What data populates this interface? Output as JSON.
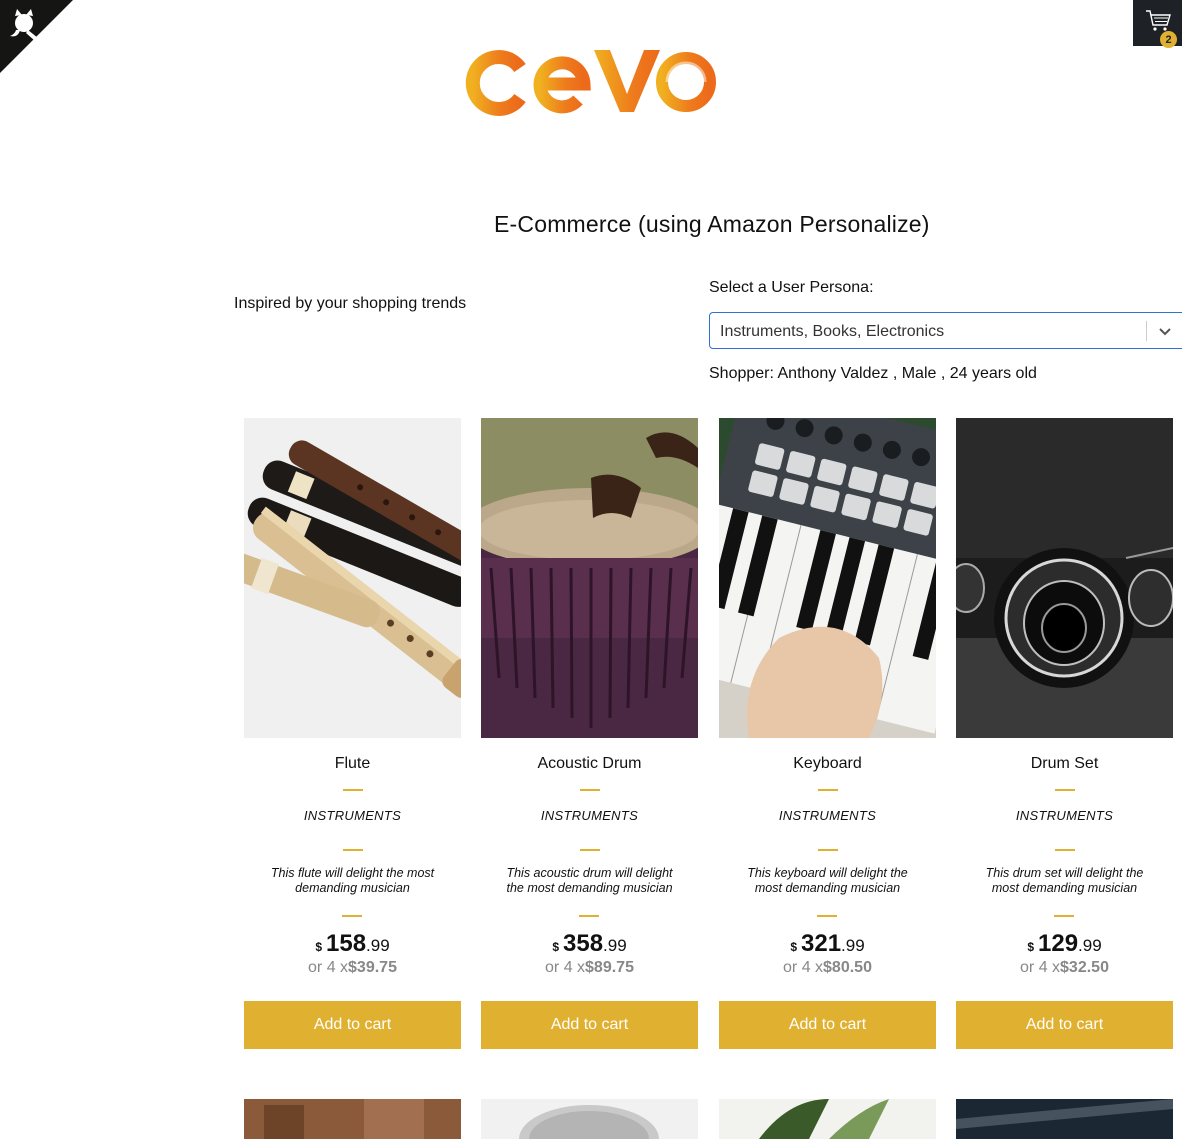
{
  "header": {
    "cart_count": "2",
    "logo_text": "cevo"
  },
  "app_title": "E-Commerce (using Amazon Personalize)",
  "inspired_text": "Inspired by your shopping trends",
  "persona": {
    "label": "Select a User Persona:",
    "selected": "Instruments, Books, Electronics",
    "shopper": "Shopper: Anthony Valdez , Male , 24 years old"
  },
  "products": [
    {
      "name": "Flute",
      "category": "INSTRUMENTS",
      "description": "This flute will delight the most demanding musician",
      "currency": "$",
      "price_whole": "158",
      "price_cents": ".99",
      "installment_prefix": "or 4 x",
      "installment": "$39.75",
      "button": "Add to cart"
    },
    {
      "name": "Acoustic Drum",
      "category": "INSTRUMENTS",
      "description": "This acoustic drum will delight the most demanding musician",
      "currency": "$",
      "price_whole": "358",
      "price_cents": ".99",
      "installment_prefix": "or 4 x",
      "installment": "$89.75",
      "button": "Add to cart"
    },
    {
      "name": "Keyboard",
      "category": "INSTRUMENTS",
      "description": "This keyboard will delight the most demanding musician",
      "currency": "$",
      "price_whole": "321",
      "price_cents": ".99",
      "installment_prefix": "or 4 x",
      "installment": "$80.50",
      "button": "Add to cart"
    },
    {
      "name": "Drum Set",
      "category": "INSTRUMENTS",
      "description": "This drum set will delight the most demanding musician",
      "currency": "$",
      "price_whole": "129",
      "price_cents": ".99",
      "installment_prefix": "or 4 x",
      "installment": "$32.50",
      "button": "Add to cart"
    }
  ],
  "colors": {
    "accent": "#e0b030",
    "select_border": "#2f6fd6",
    "cart_bg": "#1e2126"
  }
}
